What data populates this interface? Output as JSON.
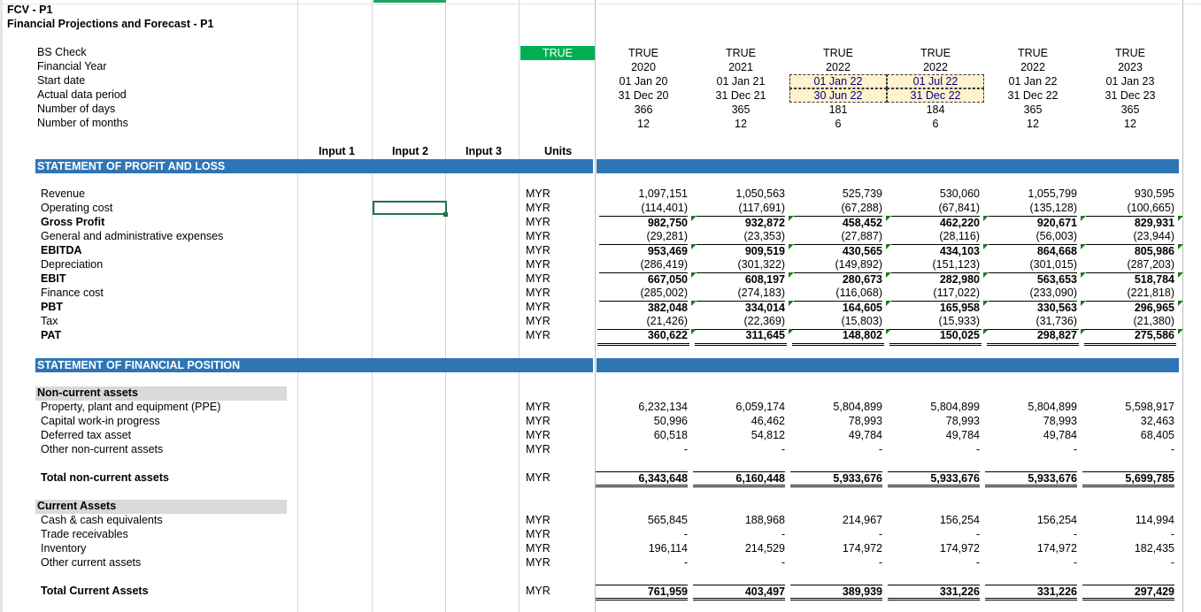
{
  "title_line1": "FCV - P1",
  "title_line2": "Financial Projections and Forecast - P1",
  "top_labels": [
    "BS Check",
    "Financial Year",
    "Start date",
    "Actual data period",
    "Number of days",
    "Number of months"
  ],
  "bs_check_value": "TRUE",
  "periods": [
    {
      "check": "TRUE",
      "year": "2020",
      "start": "01 Jan 20",
      "end": "31 Dec 20",
      "days": "366",
      "months": "12"
    },
    {
      "check": "TRUE",
      "year": "2021",
      "start": "01 Jan 21",
      "end": "31 Dec 21",
      "days": "365",
      "months": "12"
    },
    {
      "check": "TRUE",
      "year": "2022",
      "start": "01 Jan 22",
      "end": "30 Jun 22",
      "days": "181",
      "months": "6"
    },
    {
      "check": "TRUE",
      "year": "2022",
      "start": "01 Jul 22",
      "end": "31 Dec 22",
      "days": "184",
      "months": "6"
    },
    {
      "check": "TRUE",
      "year": "2022",
      "start": "01 Jan 22",
      "end": "31 Dec 22",
      "days": "365",
      "months": "12"
    },
    {
      "check": "TRUE",
      "year": "2023",
      "start": "01 Jan 23",
      "end": "31 Dec 23",
      "days": "365",
      "months": "12"
    }
  ],
  "column_headers": {
    "input1": "Input 1",
    "input2": "Input 2",
    "input3": "Input 3",
    "units": "Units"
  },
  "pl_title": "STATEMENT OF PROFIT AND LOSS",
  "pl_rows": [
    {
      "label": "Revenue",
      "bold": false,
      "unit": "MYR",
      "values": [
        "1,097,151",
        "1,050,563",
        "525,739",
        "530,060",
        "1,055,799",
        "930,595"
      ]
    },
    {
      "label": "Operating cost",
      "bold": false,
      "unit": "MYR",
      "values": [
        "(114,401)",
        "(117,691)",
        "(67,288)",
        "(67,841)",
        "(135,128)",
        "(100,665)"
      ]
    },
    {
      "label": "Gross Profit",
      "bold": true,
      "unit": "MYR",
      "values": [
        "982,750",
        "932,872",
        "458,452",
        "462,220",
        "920,671",
        "829,931"
      ]
    },
    {
      "label": "General and administrative expenses",
      "bold": false,
      "unit": "MYR",
      "values": [
        "(29,281)",
        "(23,353)",
        "(27,887)",
        "(28,116)",
        "(56,003)",
        "(23,944)"
      ]
    },
    {
      "label": "EBITDA",
      "bold": true,
      "unit": "MYR",
      "values": [
        "953,469",
        "909,519",
        "430,565",
        "434,103",
        "864,668",
        "805,986"
      ]
    },
    {
      "label": "Depreciation",
      "bold": false,
      "unit": "MYR",
      "values": [
        "(286,419)",
        "(301,322)",
        "(149,892)",
        "(151,123)",
        "(301,015)",
        "(287,203)"
      ]
    },
    {
      "label": "EBIT",
      "bold": true,
      "unit": "MYR",
      "values": [
        "667,050",
        "608,197",
        "280,673",
        "282,980",
        "563,653",
        "518,784"
      ]
    },
    {
      "label": "Finance cost",
      "bold": false,
      "unit": "MYR",
      "values": [
        "(285,002)",
        "(274,183)",
        "(116,068)",
        "(117,022)",
        "(233,090)",
        "(221,818)"
      ]
    },
    {
      "label": "PBT",
      "bold": true,
      "unit": "MYR",
      "values": [
        "382,048",
        "334,014",
        "164,605",
        "165,958",
        "330,563",
        "296,965"
      ]
    },
    {
      "label": "Tax",
      "bold": false,
      "unit": "MYR",
      "values": [
        "(21,426)",
        "(22,369)",
        "(15,803)",
        "(15,933)",
        "(31,736)",
        "(21,380)"
      ]
    },
    {
      "label": "PAT",
      "bold": true,
      "unit": "MYR",
      "values": [
        "360,622",
        "311,645",
        "148,802",
        "150,025",
        "298,827",
        "275,586"
      ]
    }
  ],
  "fp_title": "STATEMENT OF FINANCIAL POSITION",
  "ncа_placeholder": "",
  "nca_header": "Non-current assets",
  "nca_rows": [
    {
      "label": "Property, plant and equipment (PPE)",
      "unit": "MYR",
      "values": [
        "6,232,134",
        "6,059,174",
        "5,804,899",
        "5,804,899",
        "5,804,899",
        "5,598,917"
      ]
    },
    {
      "label": "Capital work-in progress",
      "unit": "MYR",
      "values": [
        "50,996",
        "46,462",
        "78,993",
        "78,993",
        "78,993",
        "32,463"
      ]
    },
    {
      "label": "Deferred tax asset",
      "unit": "MYR",
      "values": [
        "60,518",
        "54,812",
        "49,784",
        "49,784",
        "49,784",
        "68,405"
      ]
    },
    {
      "label": "Other non-current assets",
      "unit": "MYR",
      "values": [
        "-",
        "-",
        "-",
        "-",
        "-",
        "-"
      ]
    }
  ],
  "nca_total": {
    "label": "Total non-current assets",
    "unit": "MYR",
    "values": [
      "6,343,648",
      "6,160,448",
      "5,933,676",
      "5,933,676",
      "5,933,676",
      "5,699,785"
    ]
  },
  "ca_header": "Current Assets",
  "ca_rows": [
    {
      "label": "Cash & cash equivalents",
      "unit": "MYR",
      "values": [
        "565,845",
        "188,968",
        "214,967",
        "156,254",
        "156,254",
        "114,994"
      ]
    },
    {
      "label": "Trade receivables",
      "unit": "MYR",
      "values": [
        "-",
        "-",
        "-",
        "-",
        "-",
        "-"
      ]
    },
    {
      "label": "Inventory",
      "unit": "MYR",
      "values": [
        "196,114",
        "214,529",
        "174,972",
        "174,972",
        "174,972",
        "182,435"
      ]
    },
    {
      "label": "Other current assets",
      "unit": "MYR",
      "values": [
        "-",
        "-",
        "-",
        "-",
        "-",
        "-"
      ]
    }
  ],
  "ca_total": {
    "label": "Total Current Assets",
    "unit": "MYR",
    "values": [
      "761,959",
      "403,497",
      "389,939",
      "331,226",
      "331,226",
      "297,429"
    ]
  },
  "colors": {
    "band": "#2e75b6",
    "true_green": "#00b050",
    "section_gray": "#d9d9d9",
    "highlight": "#fff2cc"
  }
}
